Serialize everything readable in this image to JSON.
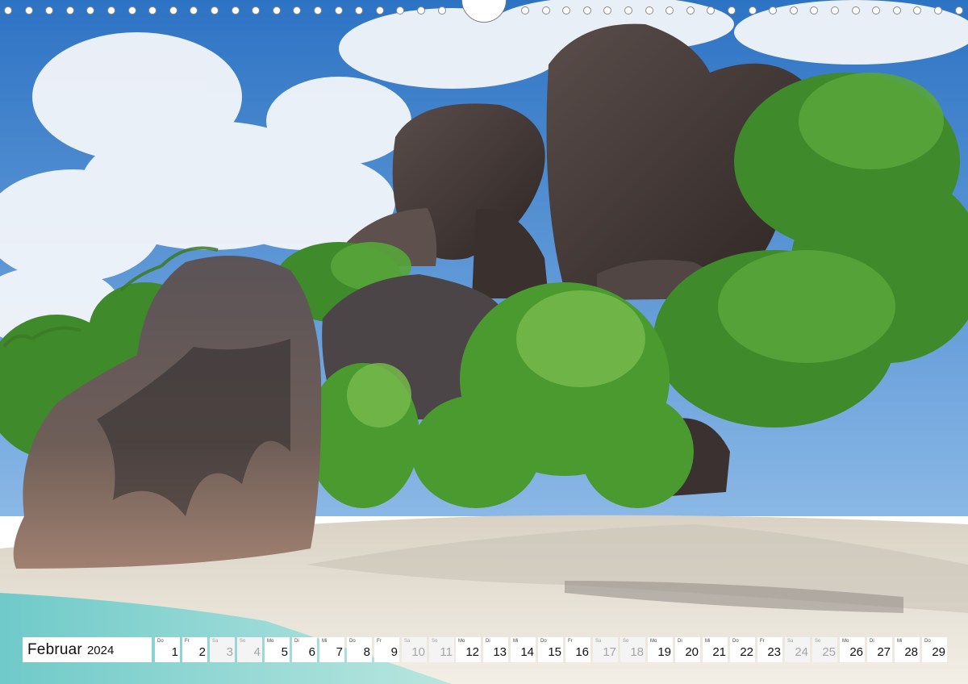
{
  "calendar": {
    "month": "Februar",
    "year": "2024",
    "days": [
      {
        "wd": "Do",
        "num": "1",
        "weekend": false
      },
      {
        "wd": "Fr",
        "num": "2",
        "weekend": false
      },
      {
        "wd": "Sa",
        "num": "3",
        "weekend": true
      },
      {
        "wd": "So",
        "num": "4",
        "weekend": true
      },
      {
        "wd": "Mo",
        "num": "5",
        "weekend": false
      },
      {
        "wd": "Di",
        "num": "6",
        "weekend": false
      },
      {
        "wd": "Mi",
        "num": "7",
        "weekend": false
      },
      {
        "wd": "Do",
        "num": "8",
        "weekend": false
      },
      {
        "wd": "Fr",
        "num": "9",
        "weekend": false
      },
      {
        "wd": "Sa",
        "num": "10",
        "weekend": true
      },
      {
        "wd": "So",
        "num": "11",
        "weekend": true
      },
      {
        "wd": "Mo",
        "num": "12",
        "weekend": false
      },
      {
        "wd": "Di",
        "num": "13",
        "weekend": false
      },
      {
        "wd": "Mi",
        "num": "14",
        "weekend": false
      },
      {
        "wd": "Do",
        "num": "15",
        "weekend": false
      },
      {
        "wd": "Fr",
        "num": "16",
        "weekend": false
      },
      {
        "wd": "Sa",
        "num": "17",
        "weekend": true
      },
      {
        "wd": "So",
        "num": "18",
        "weekend": true
      },
      {
        "wd": "Mo",
        "num": "19",
        "weekend": false
      },
      {
        "wd": "Di",
        "num": "20",
        "weekend": false
      },
      {
        "wd": "Mi",
        "num": "21",
        "weekend": false
      },
      {
        "wd": "Do",
        "num": "22",
        "weekend": false
      },
      {
        "wd": "Fr",
        "num": "23",
        "weekend": false
      },
      {
        "wd": "Sa",
        "num": "24",
        "weekend": true
      },
      {
        "wd": "So",
        "num": "25",
        "weekend": true
      },
      {
        "wd": "Mo",
        "num": "26",
        "weekend": false
      },
      {
        "wd": "Di",
        "num": "27",
        "weekend": false
      },
      {
        "wd": "Mi",
        "num": "28",
        "weekend": false
      },
      {
        "wd": "Do",
        "num": "29",
        "weekend": false
      }
    ]
  },
  "colors": {
    "sky": "#2f7fd0",
    "cloud": "#f2f6fb",
    "rock": "#4a3f3d",
    "foliage": "#3f8a2a",
    "sand": "#eae4d8",
    "water": "#7fd0d0"
  }
}
